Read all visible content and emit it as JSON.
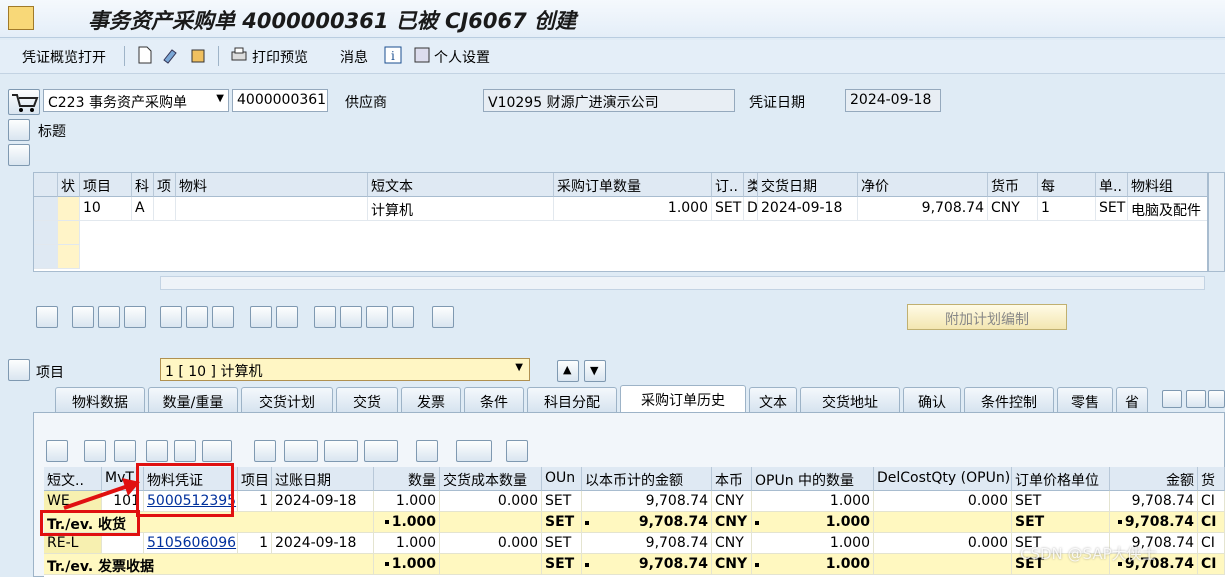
{
  "title": "事务资产采购单 4000000361 已被 CJ6067 创建",
  "toolbar": {
    "items": [
      "凭证概览打开",
      "打印预览",
      "消息",
      "个人设置"
    ]
  },
  "header": {
    "doc_type": "C223 事务资产采购单",
    "po_number": "4000000361",
    "vendor_label": "供应商",
    "vendor": "V10295 财源广进演示公司",
    "date_label": "凭证日期",
    "date": "2024-09-18"
  },
  "section_title_label": "标题",
  "items_grid": {
    "headers": [
      "状",
      "项目",
      "科",
      "项",
      "物料",
      "短文本",
      "采购订单数量",
      "订..",
      "类",
      "交货日期",
      "净价",
      "货币",
      "每",
      "单..",
      "物料组"
    ],
    "row": {
      "item": "10",
      "acct": "A",
      "short_text": "计算机",
      "qty": "1.000",
      "unit": "SET",
      "category": "D",
      "delivery_date": "2024-09-18",
      "net_price": "9,708.74",
      "currency": "CNY",
      "per": "1",
      "order_unit": "SET",
      "matl_group": "电脑及配件"
    }
  },
  "schedule_button": "附加计划编制",
  "item_selector": {
    "label": "项目",
    "value": "1 [ 10 ] 计算机"
  },
  "tabs": [
    "物料数据",
    "数量/重量",
    "交货计划",
    "交货",
    "发票",
    "条件",
    "科目分配",
    "采购订单历史",
    "文本",
    "交货地址",
    "确认",
    "条件控制",
    "零售",
    "省"
  ],
  "history": {
    "headers": [
      "短文..",
      "MvT",
      "物料凭证",
      "项目",
      "过账日期",
      "数量",
      "交货成本数量",
      "OUn",
      "以本币计的金额",
      "本币",
      "OPUn 中的数量",
      "DelCostQty (OPUn)",
      "订单价格单位",
      "金额",
      "货"
    ],
    "rows": [
      {
        "type": "WE",
        "mvt": "101",
        "doc": "5000512395",
        "item": "1",
        "date": "2024-09-18",
        "qty": "1.000",
        "dcq": "0.000",
        "oun": "SET",
        "amt_lc": "9,708.74",
        "lc": "CNY",
        "qty_opun": "1.000",
        "dcq_opun": "0.000",
        "opu": "SET",
        "amount": "9,708.74",
        "cur": "CI"
      },
      {
        "type": "Tr./ev. 收货",
        "qty": "1.000",
        "oun": "SET",
        "amt_lc": "9,708.74",
        "lc": "CNY",
        "qty_opun": "1.000",
        "opu": "SET",
        "amount": "9,708.74",
        "cur": "CI"
      },
      {
        "type": "RE-L",
        "mvt": "",
        "doc": "5105606096",
        "item": "1",
        "date": "2024-09-18",
        "qty": "1.000",
        "dcq": "0.000",
        "oun": "SET",
        "amt_lc": "9,708.74",
        "lc": "CNY",
        "qty_opun": "1.000",
        "dcq_opun": "0.000",
        "opu": "SET",
        "amount": "9,708.74",
        "cur": "CI"
      },
      {
        "type": "Tr./ev. 发票收据",
        "qty": "1.000",
        "oun": "SET",
        "amt_lc": "9,708.74",
        "lc": "CNY",
        "qty_opun": "1.000",
        "opu": "SET",
        "amount": "9,708.74",
        "cur": "CI"
      }
    ]
  },
  "watermark": "CSDN @SAP大侠士",
  "colors": {
    "accent": "#e01010",
    "link": "#00309c",
    "sum_row": "#fff8c0"
  }
}
